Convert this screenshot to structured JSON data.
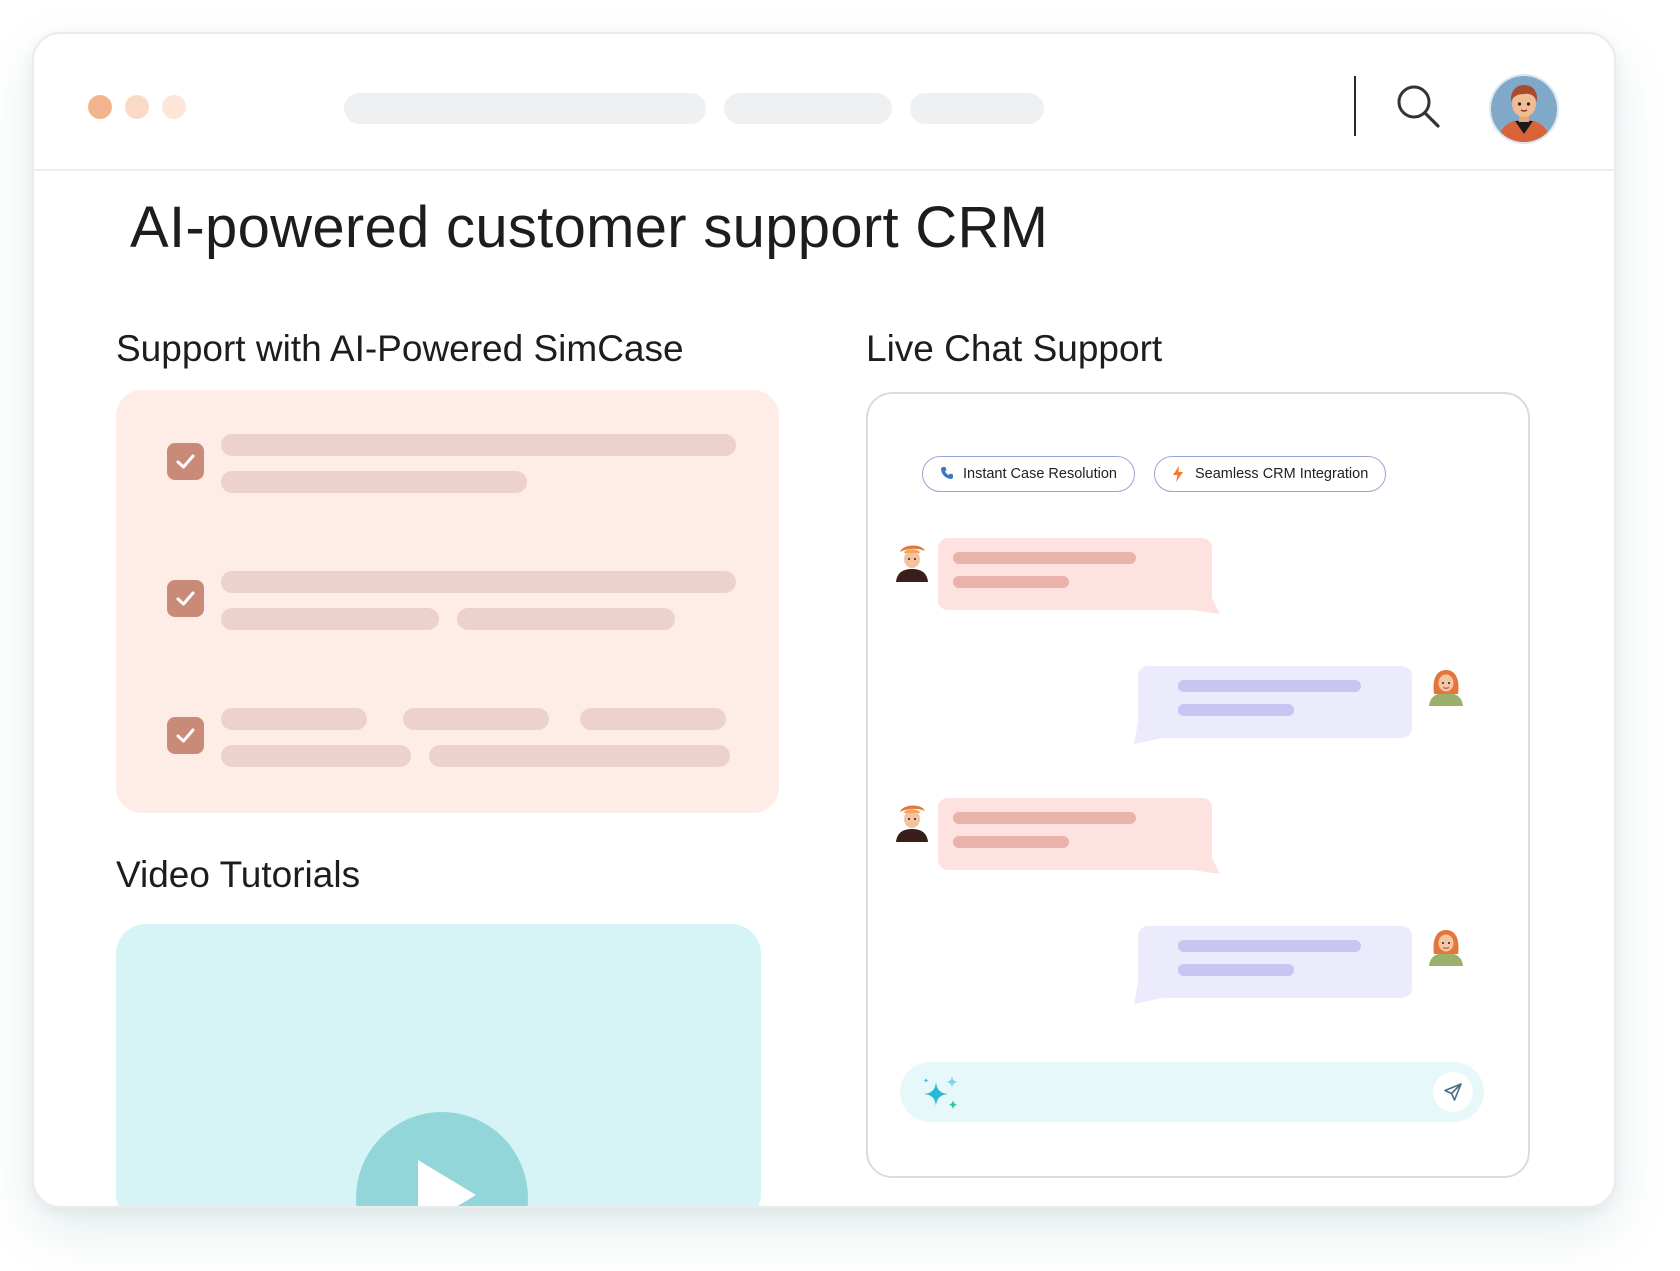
{
  "browser": {
    "window_controls": [
      "close-dot",
      "minimize-dot",
      "maximize-dot"
    ],
    "dot_colors": [
      "#f2b48f",
      "#fad9c6",
      "#fde5d8"
    ],
    "icons": {
      "search": "search-icon",
      "profile": "avatar"
    }
  },
  "page": {
    "title": "AI-powered customer support CRM"
  },
  "simcase": {
    "heading": "Support with AI-Powered SimCase",
    "items": [
      {
        "checked": true,
        "icon": "checkbox-checked-icon"
      },
      {
        "checked": true,
        "icon": "checkbox-checked-icon"
      },
      {
        "checked": true,
        "icon": "checkbox-checked-icon"
      }
    ]
  },
  "video": {
    "heading": "Video Tutorials",
    "icon": "play-icon"
  },
  "live_chat": {
    "heading": "Live Chat Support",
    "chips": [
      {
        "label": "Instant Case Resolution",
        "icon": "phone-icon"
      },
      {
        "label": "Seamless CRM Integration",
        "icon": "lightning-icon"
      }
    ],
    "messages": [
      {
        "from": "customer"
      },
      {
        "from": "agent"
      },
      {
        "from": "customer"
      },
      {
        "from": "agent"
      }
    ],
    "input": {
      "icons": [
        "ai-sparkle-icon",
        "send-icon"
      ]
    }
  },
  "colors": {
    "accent_peach": "#feece6",
    "checkbox": "#c98a78",
    "video_bg": "#d6f4f5",
    "incoming_bubble": "#fde2df",
    "outgoing_bubble": "#ecebfc",
    "chip_border": "#9aa4d8"
  }
}
